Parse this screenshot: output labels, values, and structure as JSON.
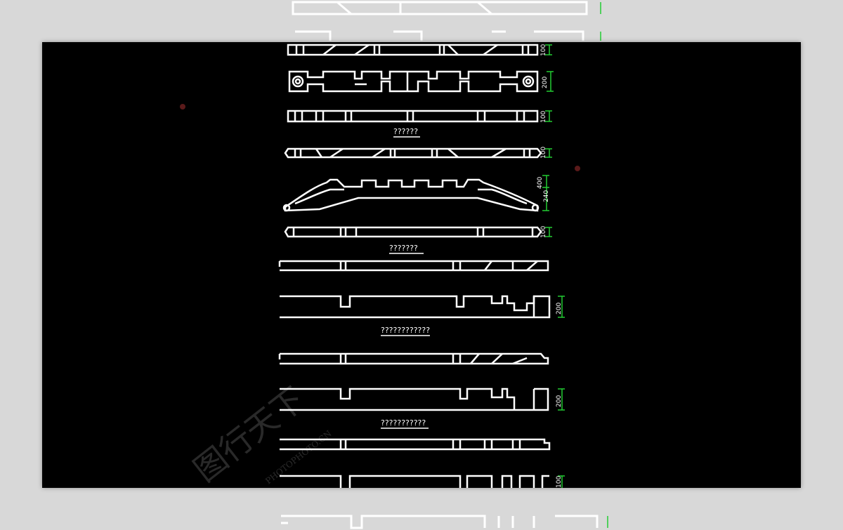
{
  "colors": {
    "page_background": "#d8d8d8",
    "canvas_background": "#000000",
    "drawing_line": "#ffffff",
    "dimension_line": "#22cc33"
  },
  "drawing": {
    "section_labels": [
      "??????",
      "???????",
      "????????????",
      "???????????"
    ],
    "dimensions": [
      "100",
      "200",
      "100",
      "100",
      "400",
      "240",
      "100",
      "200",
      "200",
      "100"
    ]
  },
  "watermark": {
    "logo_text": "图行天下",
    "url_text": "PHOTOPHOTO.CN"
  }
}
